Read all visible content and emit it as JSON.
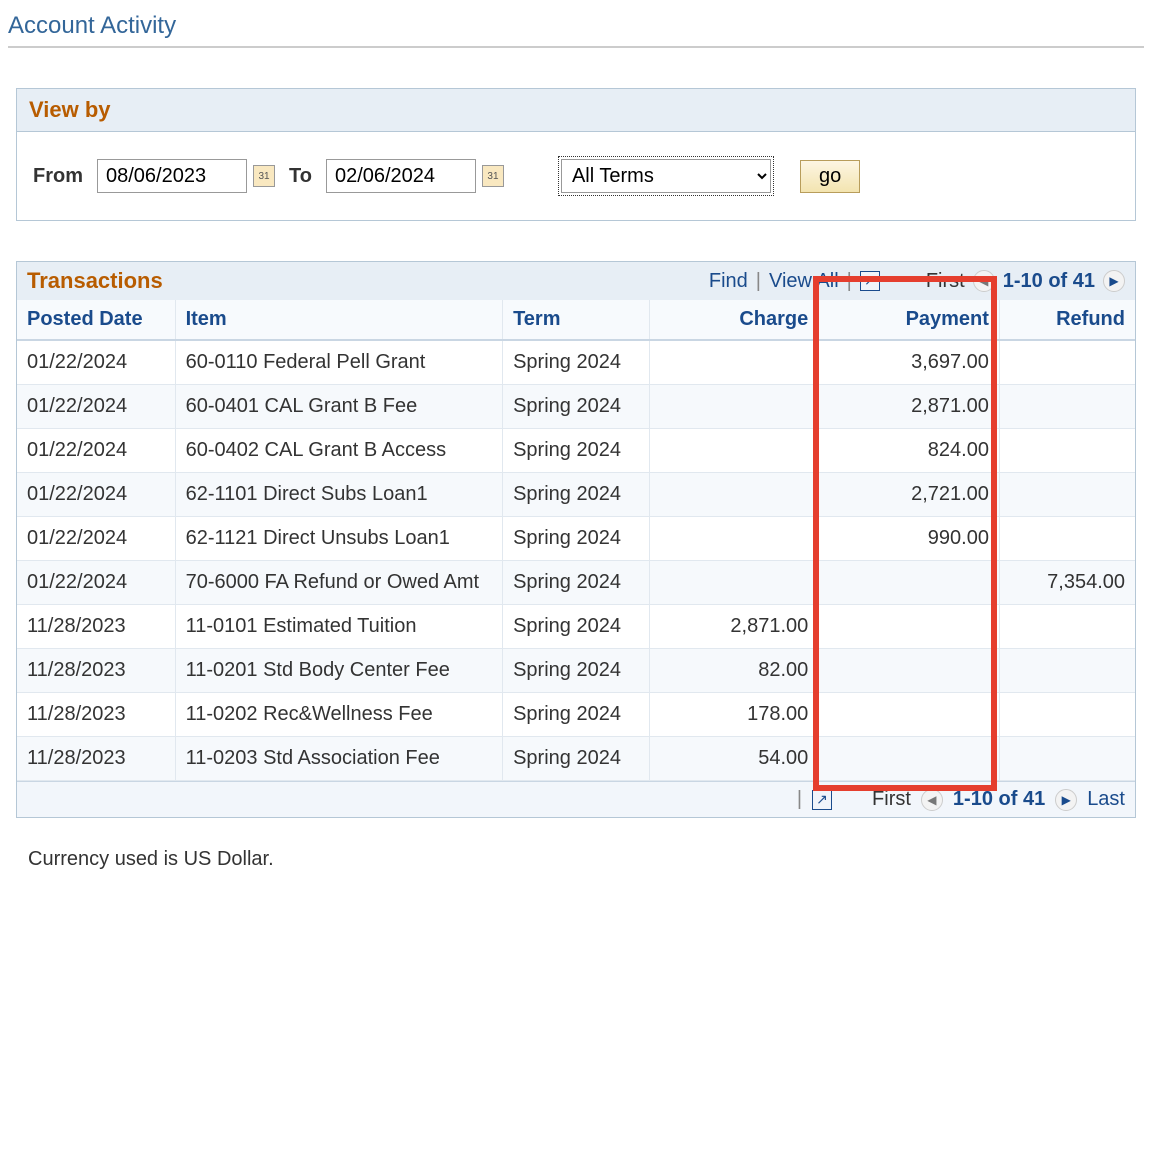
{
  "pageTitle": "Account Activity",
  "viewBy": {
    "header": "View by",
    "fromLabel": "From",
    "toLabel": "To",
    "fromDate": "08/06/2023",
    "toDate": "02/06/2024",
    "termSelect": "All Terms",
    "goLabel": "go"
  },
  "transactions": {
    "header": "Transactions",
    "findLabel": "Find",
    "viewAllLabel": "View All",
    "firstLabel": "First",
    "lastLabel": "Last",
    "range": "1-10 of 41",
    "columns": {
      "postedDate": "Posted Date",
      "item": "Item",
      "term": "Term",
      "charge": "Charge",
      "payment": "Payment",
      "refund": "Refund"
    },
    "rows": [
      {
        "date": "01/22/2024",
        "item": "60-0110 Federal Pell Grant",
        "term": "Spring 2024",
        "charge": "",
        "payment": "3,697.00",
        "refund": ""
      },
      {
        "date": "01/22/2024",
        "item": "60-0401 CAL Grant B Fee",
        "term": "Spring 2024",
        "charge": "",
        "payment": "2,871.00",
        "refund": ""
      },
      {
        "date": "01/22/2024",
        "item": "60-0402 CAL Grant B Access",
        "term": "Spring 2024",
        "charge": "",
        "payment": "824.00",
        "refund": ""
      },
      {
        "date": "01/22/2024",
        "item": "62-1101 Direct Subs Loan1",
        "term": "Spring 2024",
        "charge": "",
        "payment": "2,721.00",
        "refund": ""
      },
      {
        "date": "01/22/2024",
        "item": "62-1121 Direct Unsubs Loan1",
        "term": "Spring 2024",
        "charge": "",
        "payment": "990.00",
        "refund": ""
      },
      {
        "date": "01/22/2024",
        "item": "70-6000 FA Refund or Owed Amt",
        "term": "Spring 2024",
        "charge": "",
        "payment": "",
        "refund": "7,354.00"
      },
      {
        "date": "11/28/2023",
        "item": "11-0101 Estimated Tuition",
        "term": "Spring 2024",
        "charge": "2,871.00",
        "payment": "",
        "refund": ""
      },
      {
        "date": "11/28/2023",
        "item": "11-0201 Std Body Center Fee",
        "term": "Spring 2024",
        "charge": "82.00",
        "payment": "",
        "refund": ""
      },
      {
        "date": "11/28/2023",
        "item": "11-0202 Rec&Wellness Fee",
        "term": "Spring 2024",
        "charge": "178.00",
        "payment": "",
        "refund": ""
      },
      {
        "date": "11/28/2023",
        "item": "11-0203 Std Association Fee",
        "term": "Spring 2024",
        "charge": "54.00",
        "payment": "",
        "refund": ""
      }
    ]
  },
  "currencyNote": "Currency used is US Dollar."
}
